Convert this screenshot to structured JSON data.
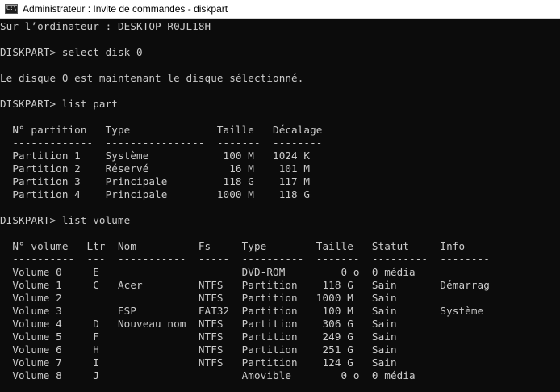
{
  "window": {
    "title": "Administrateur : Invite de commandes - diskpart",
    "icon": "cmd-icon"
  },
  "colors": {
    "background": "#0c0c0c",
    "text": "#cccccc",
    "titlebar": "#ffffff"
  },
  "console": {
    "lines": [
      "Sur l’ordinateur : DESKTOP-R0JL18H",
      "",
      "DISKPART> select disk 0",
      "",
      "Le disque 0 est maintenant le disque sélectionné.",
      "",
      "DISKPART> list part",
      "",
      "  N° partition   Type              Taille   Décalage",
      "  -------------  ----------------  -------  --------",
      "  Partition 1    Système            100 M   1024 K",
      "  Partition 2    Réservé             16 M    101 M",
      "  Partition 3    Principale         118 G    117 M",
      "  Partition 4    Principale        1000 M    118 G",
      "",
      "DISKPART> list volume",
      "",
      "  N° volume   Ltr  Nom          Fs     Type        Taille   Statut     Info",
      "  ----------  ---  -----------  -----  ----------  -------  ---------  --------",
      "  Volume 0     E                       DVD-ROM         0 o  0 média",
      "  Volume 1     C   Acer         NTFS   Partition    118 G   Sain       Démarrag",
      "  Volume 2                      NTFS   Partition   1000 M   Sain",
      "  Volume 3         ESP          FAT32  Partition    100 M   Sain       Système",
      "  Volume 4     D   Nouveau nom  NTFS   Partition    306 G   Sain",
      "  Volume 5     F                NTFS   Partition    249 G   Sain",
      "  Volume 6     H                NTFS   Partition    251 G   Sain",
      "  Volume 7     I                NTFS   Partition    124 G   Sain",
      "  Volume 8     J                       Amovible        0 o  0 média"
    ]
  }
}
